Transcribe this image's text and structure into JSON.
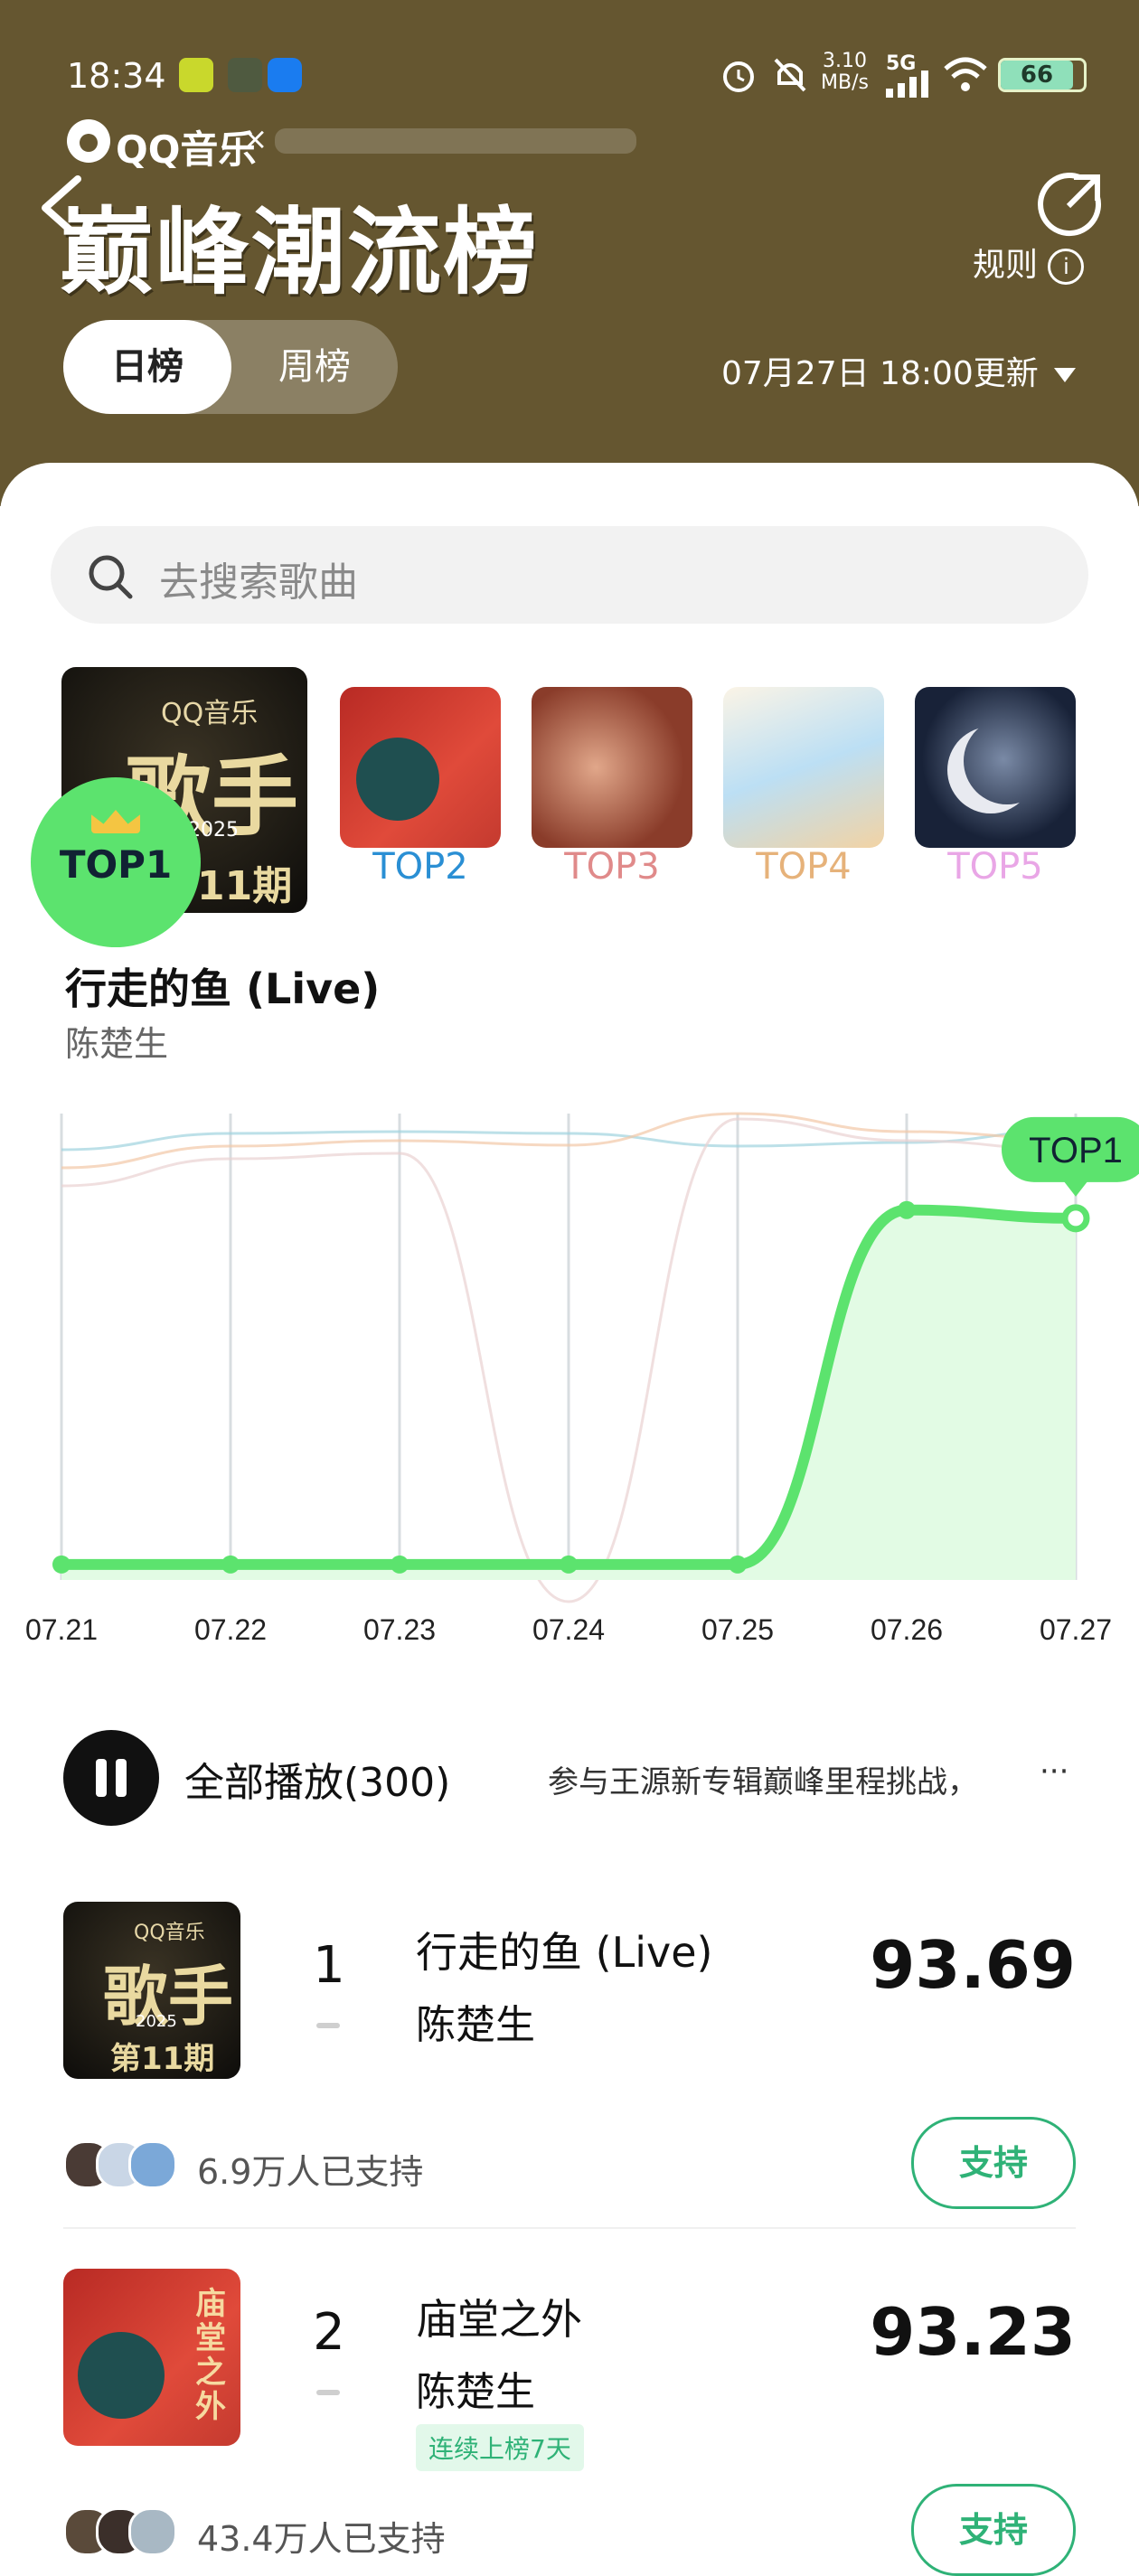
{
  "status_bar": {
    "time": "18:34",
    "net_speed_value": "3.10",
    "net_speed_unit": "MB/s",
    "network": "5G",
    "battery": "66",
    "icons": [
      "app-icon",
      "shield-icon",
      "chat-icon",
      "alarm-icon",
      "mute-bell-icon",
      "signal-icon",
      "wifi-icon",
      "battery-icon"
    ]
  },
  "header": {
    "brand": "QQ音乐",
    "brand_x": "×",
    "title": "巅峰潮流榜",
    "rules_label": "规则",
    "tabs": [
      "日榜",
      "周榜"
    ],
    "active_tab": "日榜",
    "update_time": "07月27日 18:00更新",
    "bg_color": "#655630"
  },
  "search": {
    "placeholder": "去搜索歌曲"
  },
  "top_covers": {
    "labels": [
      "TOP1",
      "TOP2",
      "TOP3",
      "TOP4",
      "TOP5"
    ],
    "label_colors": [
      "#123123",
      "#2a8fd4",
      "#e08a8a",
      "#e6b27a",
      "#e9a6e6"
    ],
    "cover1_text": {
      "brand": "QQ音乐",
      "big": "歌手",
      "year": "2025",
      "issue": "11期"
    }
  },
  "featured": {
    "song": "行走的鱼 (Live)",
    "artist": "陈楚生",
    "top_badge": "TOP1"
  },
  "chart_data": {
    "type": "line",
    "x": [
      "07.21",
      "07.22",
      "07.23",
      "07.24",
      "07.25",
      "07.26",
      "07.27"
    ],
    "yaxis": "rank (top = 1)",
    "series": [
      {
        "name": "行走的鱼 (Live)",
        "highlight": true,
        "rank_level": [
          0.02,
          0.02,
          0.02,
          0.02,
          0.02,
          0.88,
          0.86
        ]
      }
    ],
    "end_label": "TOP1",
    "accent": "#5ce36e",
    "grid": true
  },
  "list": {
    "play_all": "全部播放(300)",
    "marquee": "参与王源新专辑巅峰里程挑战，",
    "more": "···",
    "items": [
      {
        "rank": "1",
        "title": "行走的鱼 (Live)",
        "artist": "陈楚生",
        "score": "93.69",
        "supporters": "6.9万人已支持",
        "button": "支持",
        "streak": "",
        "cover_text": {
          "brand": "QQ音乐",
          "big": "歌手",
          "year": "2025",
          "issue": "第11期"
        }
      },
      {
        "rank": "2",
        "title": "庙堂之外",
        "artist": "陈楚生",
        "score": "93.23",
        "supporters": "43.4万人已支持",
        "button": "支持",
        "streak": "连续上榜7天",
        "cover_text": {
          "big": "庙堂之外"
        }
      }
    ]
  }
}
